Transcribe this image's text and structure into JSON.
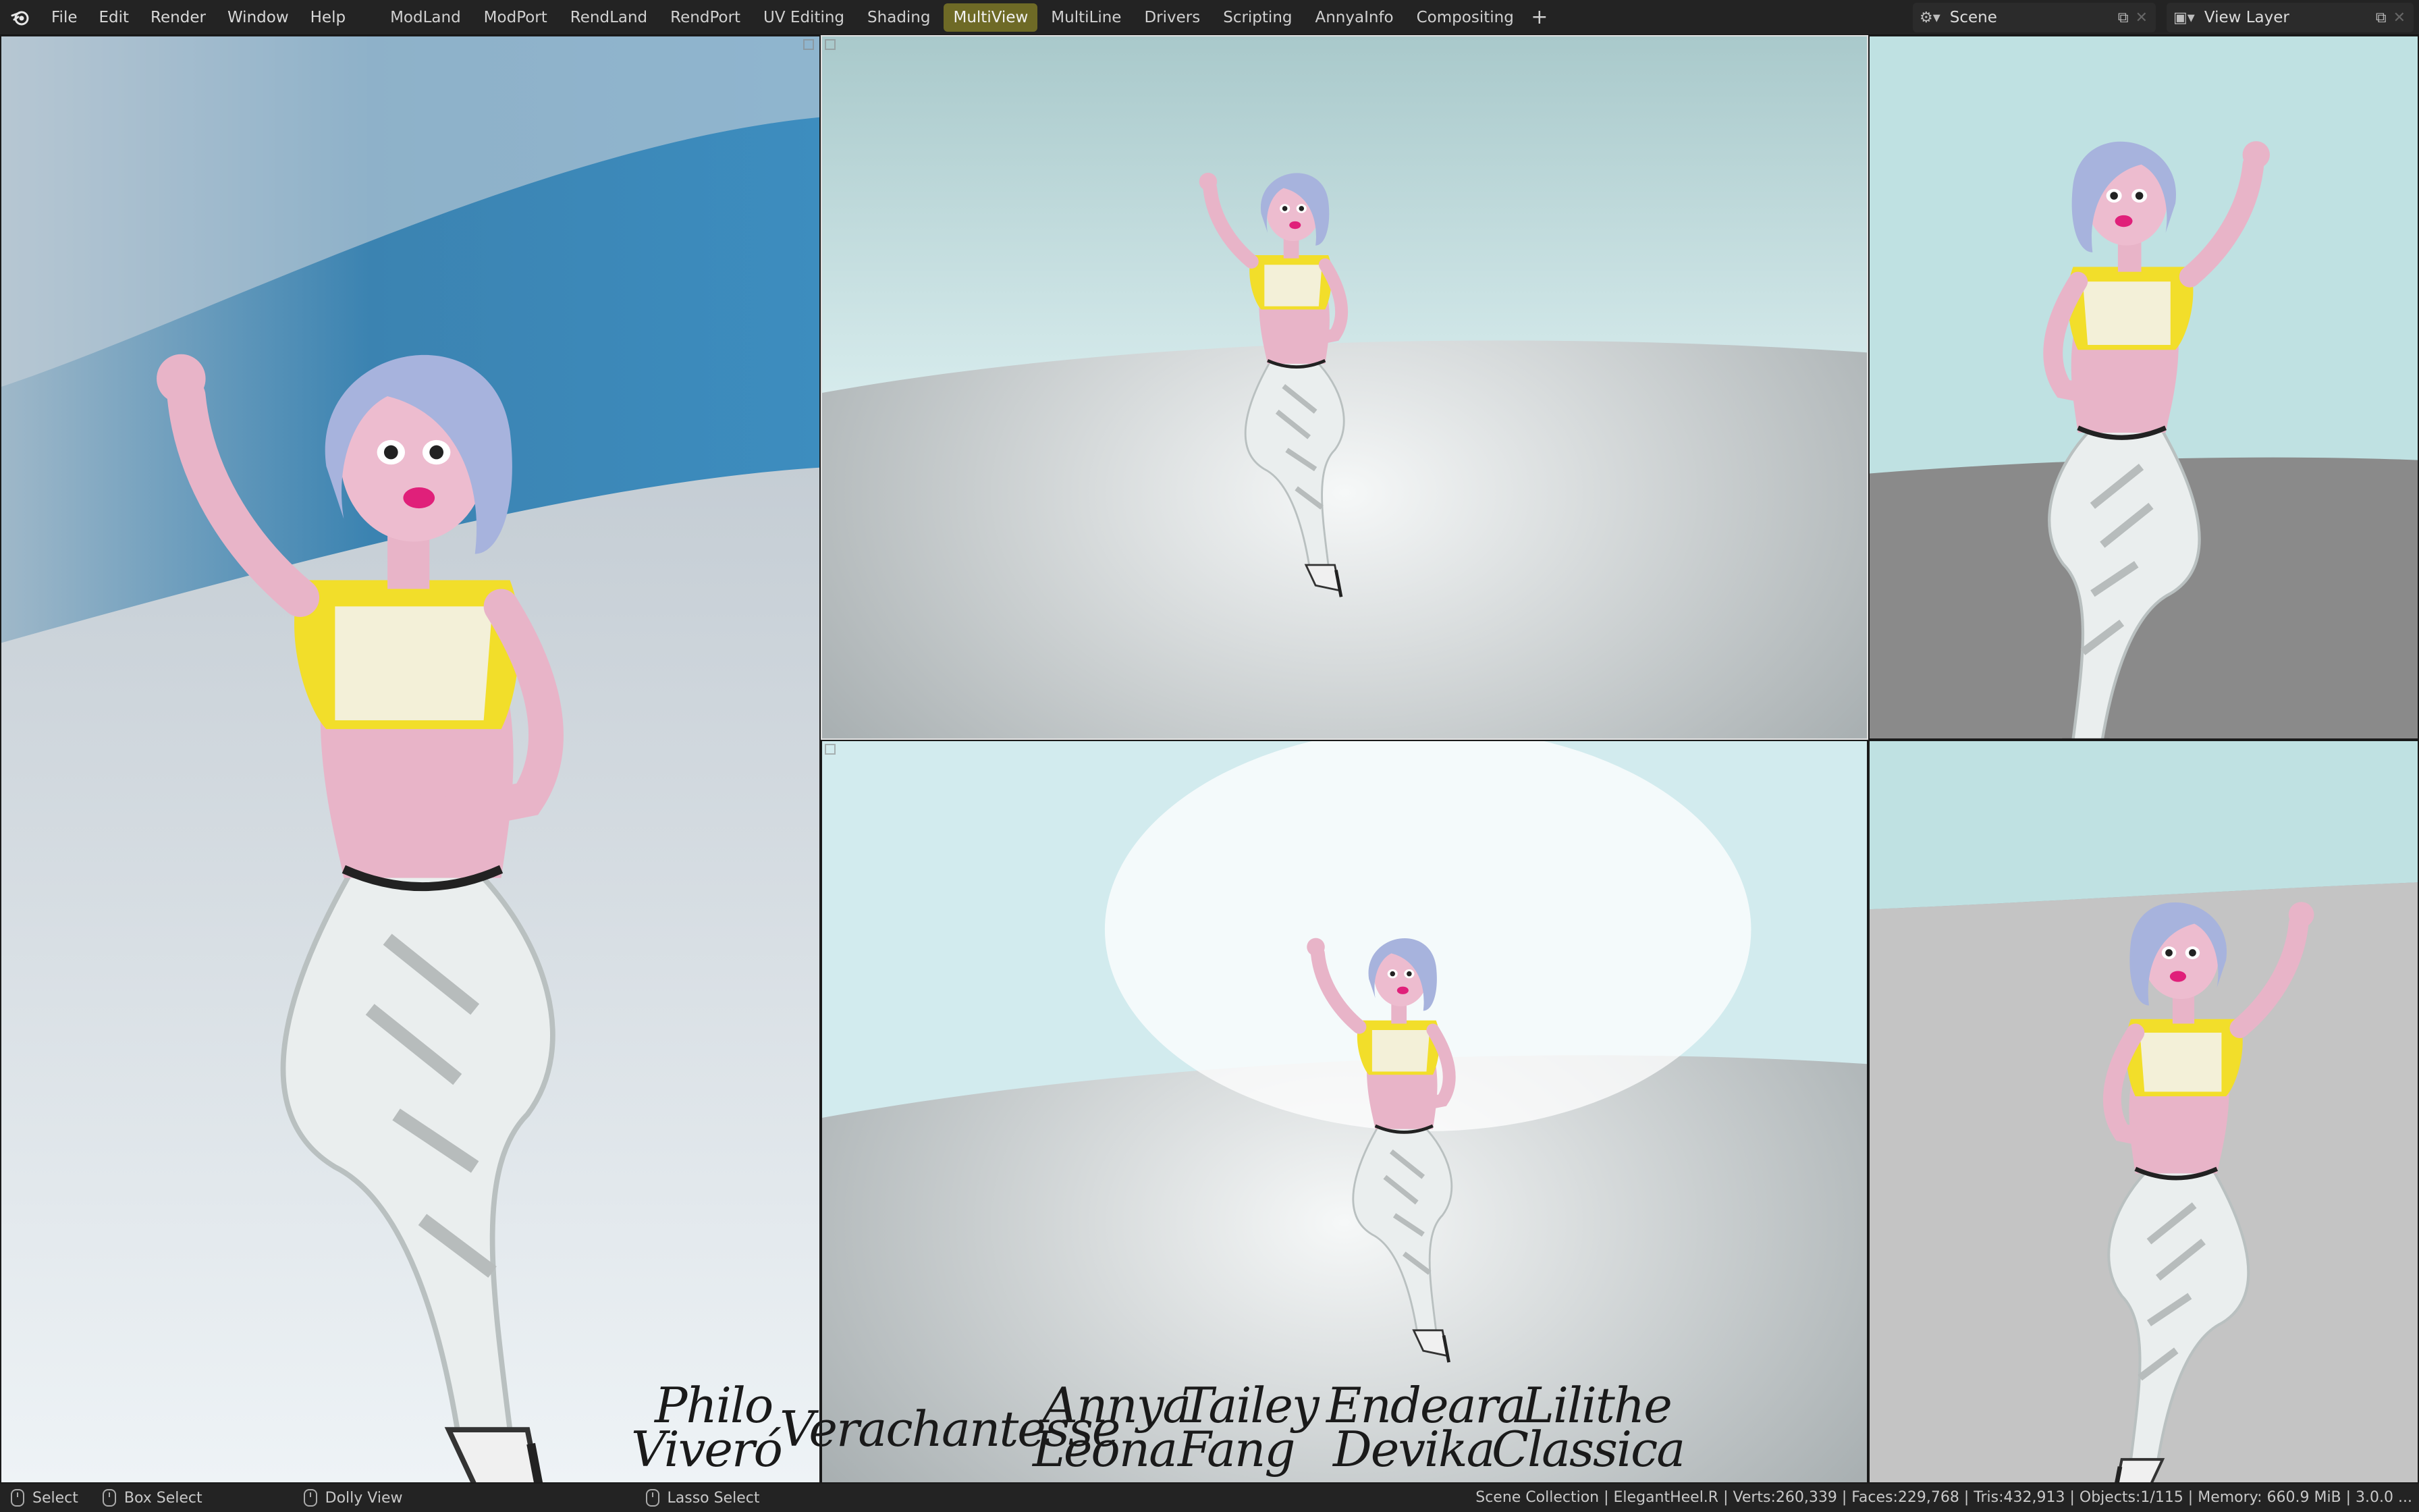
{
  "app": {
    "logo_icon": "blender-logo-icon"
  },
  "menu": [
    "File",
    "Edit",
    "Render",
    "Window",
    "Help"
  ],
  "workspaces": [
    {
      "label": "ModLand",
      "active": false
    },
    {
      "label": "ModPort",
      "active": false
    },
    {
      "label": "RendLand",
      "active": false
    },
    {
      "label": "RendPort",
      "active": false
    },
    {
      "label": "UV Editing",
      "active": false
    },
    {
      "label": "Shading",
      "active": false
    },
    {
      "label": "MultiView",
      "active": true
    },
    {
      "label": "MultiLine",
      "active": false
    },
    {
      "label": "Drivers",
      "active": false
    },
    {
      "label": "Scripting",
      "active": false
    },
    {
      "label": "AnnyaInfo",
      "active": false
    },
    {
      "label": "Compositing",
      "active": false
    }
  ],
  "add_workspace": "+",
  "scene": {
    "label": "Scene",
    "icon": "scene-icon"
  },
  "view_layer": {
    "label": "View Layer",
    "icon": "view-layer-icon"
  },
  "colors": {
    "active_tab": "#6e6a26",
    "shirt": "#f2de2a",
    "hair": "#a7b3dd",
    "skin": "#e8b4c8",
    "wall": "#bcd9dc"
  },
  "signature": {
    "names": [
      "Philo",
      "Viveró",
      "Verachantesse",
      "Annya",
      "Leona",
      "Tailey",
      "Fang",
      "Endeara",
      "Devika",
      "Lilithe",
      "Classica"
    ]
  },
  "statusbar": {
    "select": "Select",
    "box_select": "Box Select",
    "dolly_view": "Dolly View",
    "lasso_select": "Lasso Select",
    "stats": "Scene Collection | ElegantHeel.R | Verts:260,339 | Faces:229,768 | Tris:432,913 | Objects:1/115 | Memory: 660.9 MiB | 3.0.0 ..."
  }
}
